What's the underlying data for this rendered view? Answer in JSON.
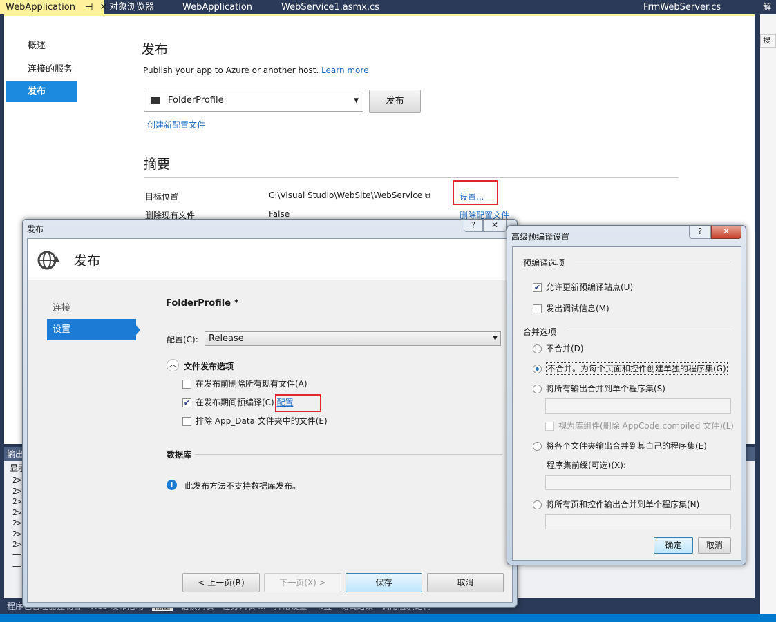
{
  "tabs": [
    {
      "label": "WebApplication",
      "pin": "⊣",
      "close": "✕"
    },
    {
      "label": "对象浏览器"
    },
    {
      "label": "WebApplication"
    },
    {
      "label": "WebService1.asmx.cs"
    },
    {
      "label": "FrmWebServer.cs"
    }
  ],
  "right_panel": {
    "title": "解决",
    "search": "搜索"
  },
  "nav": [
    {
      "label": "概述"
    },
    {
      "label": "连接的服务"
    },
    {
      "label": "发布",
      "selected": true
    }
  ],
  "publish_page": {
    "title": "发布",
    "subtitle": "Publish your app to Azure or another host.",
    "learn_more": "Learn more",
    "profile": "FolderProfile",
    "publish_button": "发布",
    "create_profile": "创建新配置文件",
    "summary": {
      "title": "摘要",
      "rows": [
        {
          "label": "目标位置",
          "value": "C:\\Visual Studio\\WebSite\\WebService",
          "action": "设置..."
        },
        {
          "label": "删除现有文件",
          "value": "False",
          "action": "删除配置文件"
        }
      ]
    }
  },
  "output": {
    "title": "输出",
    "show": "显示",
    "lines": [
      "2>",
      "2>",
      "2>",
      "2>",
      "2>",
      "2>",
      "2>",
      "==",
      "=="
    ]
  },
  "bottom_tabs": [
    "程序包管理器控制台",
    "Web 发布活动",
    "输出",
    "错误列表",
    "任务列表 ...",
    "异常设置",
    "书签",
    "测试结果",
    "调用层次结构"
  ],
  "publish_dialog": {
    "window_title": "发布",
    "help": "?",
    "close": "✕",
    "header": "发布",
    "steps": [
      {
        "label": "连接"
      },
      {
        "label": "设置",
        "selected": true
      }
    ],
    "profile_name": "FolderProfile *",
    "config_label": "配置(C):",
    "config_value": "Release",
    "file_options_title": "文件发布选项",
    "options": [
      {
        "label": "在发布前删除所有现有文件(A)",
        "checked": false
      },
      {
        "label": "在发布期间预编译(C)",
        "checked": true,
        "link": "配置"
      },
      {
        "label": "排除 App_Data 文件夹中的文件(E)",
        "checked": false
      }
    ],
    "database_title": "数据库",
    "database_info": "此发布方法不支持数据库发布。",
    "buttons": {
      "prev": "< 上一页(R)",
      "next": "下一页(X) >",
      "save": "保存",
      "cancel": "取消"
    }
  },
  "advanced_dialog": {
    "title": "高级预编译设置",
    "help": "?",
    "close": "✕",
    "precompile_title": "预编译选项",
    "precompile": [
      {
        "label": "允许更新预编译站点(U)",
        "checked": true
      },
      {
        "label": "发出调试信息(M)",
        "checked": false
      }
    ],
    "merge_title": "合并选项",
    "merge": [
      {
        "label": "不合并(D)",
        "selected": false
      },
      {
        "label": "不合并。为每个页面和控件创建单独的程序集(G)",
        "selected": true
      },
      {
        "label": "将所有输出合并到单个程序集(S)",
        "selected": false
      },
      {
        "label": "将各个文件夹输出合并到其自己的程序集(E)",
        "selected": false
      },
      {
        "label": "将所有页和控件输出合并到单个程序集(N)",
        "selected": false
      }
    ],
    "library_checkbox": "视为库组件(删除 AppCode.compiled 文件)(L)",
    "prefix_label": "程序集前缀(可选)(X):",
    "ok": "确定",
    "cancel": "取消"
  },
  "colors": {
    "accent": "#1c8ade",
    "highlight": "#e0262e",
    "tab_active": "#fff29d"
  }
}
